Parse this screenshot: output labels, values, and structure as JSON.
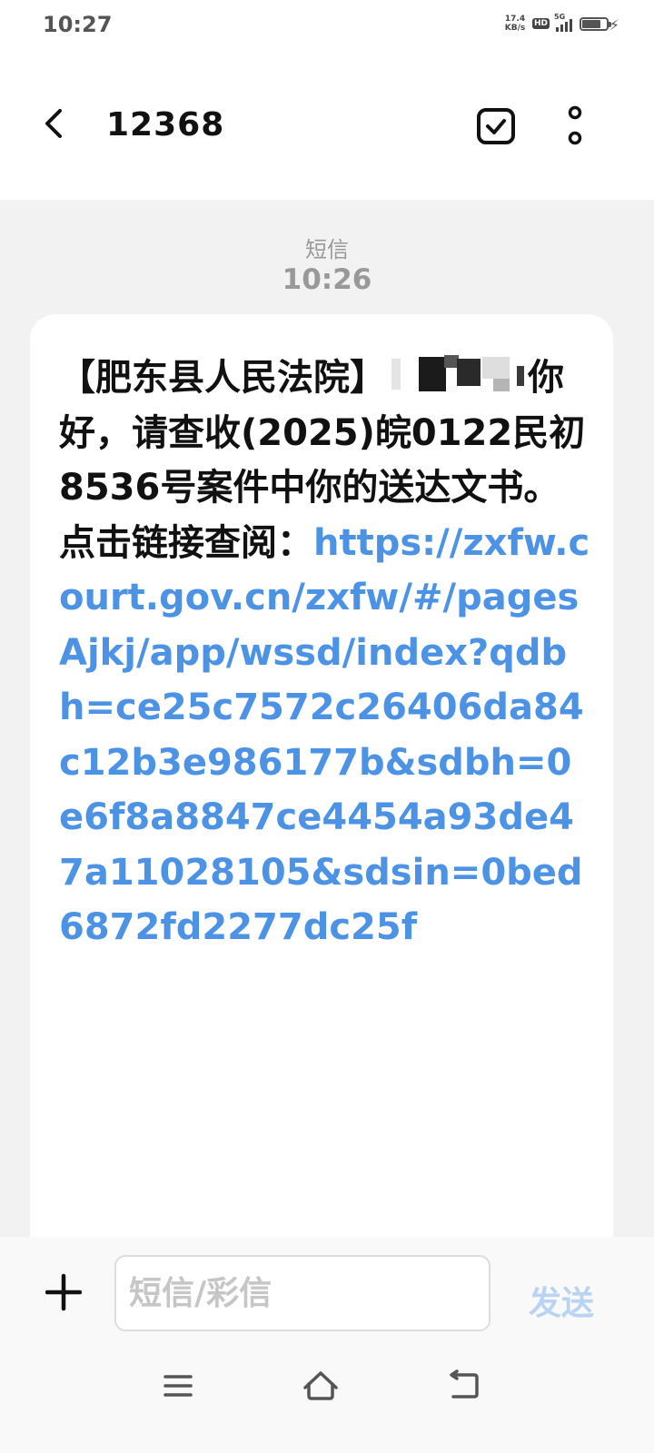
{
  "status_bar": {
    "time": "10:27",
    "net_speed": "17.4",
    "net_unit": "KB/s",
    "hd": "HD",
    "signal_label": "5G"
  },
  "header": {
    "title": "12368"
  },
  "message": {
    "type_label": "短信",
    "time": "10:26",
    "sender_tag": "【肥东县人民法院】",
    "body": "你好，请查收(2025)皖0122民初8536号案件中你的送达文书。点击链接查阅：",
    "link": "https://zxfw.court.gov.cn/zxfw/#/pagesAjkj/app/wssd/index?qdbh=ce25c7572c26406da84c12b3e986177b&sdbh=0e6f8a8847ce4454a93de47a11028105&sdsin=0bed6872fd2277dc25f"
  },
  "input_bar": {
    "placeholder": "短信/彩信",
    "send_label": "发送"
  },
  "colors": {
    "link": "#4c93e6",
    "send_disabled": "#b9d4f3",
    "background": "#f2f2f2",
    "bubble": "#ffffff"
  },
  "icons": [
    "back-arrow-icon",
    "checkbox-select-icon",
    "more-vertical-icon",
    "plus-icon",
    "menu-icon",
    "home-icon",
    "back-nav-icon"
  ]
}
